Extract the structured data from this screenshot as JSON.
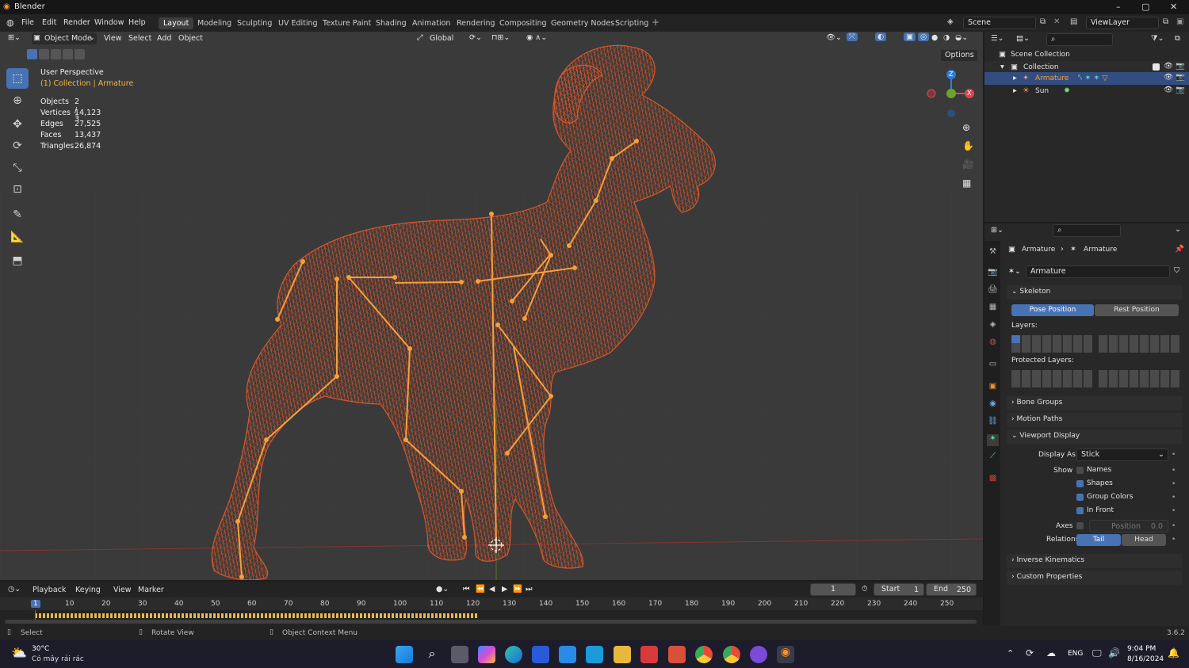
{
  "window": {
    "title": "Blender",
    "minimize": "–",
    "maximize": "▢",
    "close": "✕"
  },
  "menu": {
    "file": "File",
    "edit": "Edit",
    "render": "Render",
    "window": "Window",
    "help": "Help"
  },
  "workspaces": [
    "Layout",
    "Modeling",
    "Sculpting",
    "UV Editing",
    "Texture Paint",
    "Shading",
    "Animation",
    "Rendering",
    "Compositing",
    "Geometry Nodes",
    "Scripting"
  ],
  "scene": {
    "name": "Scene",
    "view_layer": "ViewLayer"
  },
  "viewport": {
    "mode": "Object Mode",
    "menus": [
      "View",
      "Select",
      "Add",
      "Object"
    ],
    "transform_orientation": "Global",
    "options": "Options",
    "perspective": "User Perspective",
    "collection": "(1) Collection | Armature",
    "stats": {
      "objects_label": "Objects",
      "objects": "2 / 3",
      "vertices_label": "Vertices",
      "vertices": "14,123",
      "edges_label": "Edges",
      "edges": "27,525",
      "faces_label": "Faces",
      "faces": "13,437",
      "triangles_label": "Triangles",
      "triangles": "26,874"
    },
    "gizmo": {
      "z": "Z",
      "x": "X"
    }
  },
  "outliner": {
    "root": "Scene Collection",
    "collection": "Collection",
    "items": [
      {
        "name": "Armature"
      },
      {
        "name": "Sun"
      }
    ]
  },
  "properties": {
    "breadcrumb_object": "Armature",
    "breadcrumb_data": "Armature",
    "data_name": "Armature",
    "skeleton_title": "Skeleton",
    "pose_position": "Pose Position",
    "rest_position": "Rest Position",
    "layers_label": "Layers:",
    "protected_layers_label": "Protected Layers:",
    "collapsed_panels_1": [
      "Bone Groups",
      "Motion Paths"
    ],
    "viewport_display_title": "Viewport Display",
    "display_as_label": "Display As",
    "display_as_value": "Stick",
    "show_label": "Show",
    "show_options": [
      {
        "label": "Names",
        "checked": false
      },
      {
        "label": "Shapes",
        "checked": true
      },
      {
        "label": "Group Colors",
        "checked": true
      },
      {
        "label": "In Front",
        "checked": true
      }
    ],
    "axes_label": "Axes",
    "position_label": "Position",
    "position_value": "0.0",
    "relations_label": "Relations",
    "relations_tail": "Tail",
    "relations_head": "Head",
    "collapsed_panels_2": [
      "Inverse Kinematics",
      "Custom Properties"
    ]
  },
  "timeline": {
    "menus": [
      "Playback",
      "Keying",
      "View",
      "Marker"
    ],
    "current_frame": "1",
    "start_label": "Start",
    "start": "1",
    "end_label": "End",
    "end": "250",
    "ticks": [
      "1",
      "10",
      "20",
      "30",
      "40",
      "50",
      "60",
      "70",
      "80",
      "90",
      "100",
      "110",
      "120",
      "130",
      "140",
      "150",
      "160",
      "170",
      "180",
      "190",
      "200",
      "210",
      "220",
      "230",
      "240",
      "250"
    ]
  },
  "statusbar": {
    "select": "Select",
    "rotate": "Rotate View",
    "context": "Object Context Menu",
    "version": "3.6.2"
  },
  "taskbar": {
    "temp": "30°C",
    "weather": "Có mây rải rác",
    "lang": "ENG",
    "time": "9:04 PM",
    "date": "8/16/2024"
  },
  "colors": {
    "accent": "#4772b3",
    "selected_orange": "#f5a03c",
    "mesh_orange": "#e0582a",
    "viewport_bg": "#3a3a3a"
  }
}
